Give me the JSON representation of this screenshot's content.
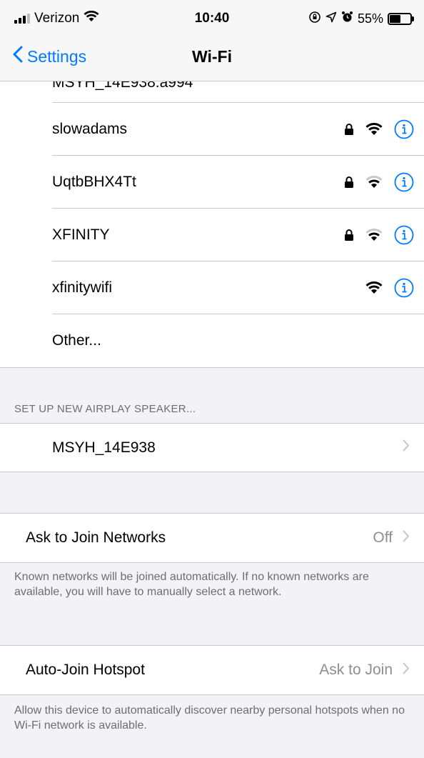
{
  "status_bar": {
    "carrier": "Verizon",
    "time": "10:40",
    "battery": "55%",
    "battery_level": 0.55
  },
  "nav": {
    "back_label": "Settings",
    "title": "Wi-Fi"
  },
  "partial_network": "MSYH_14E938.a994",
  "networks": [
    {
      "name": "slowadams",
      "locked": true,
      "strength": 3
    },
    {
      "name": "UqtbBHX4Tt",
      "locked": true,
      "strength": 2
    },
    {
      "name": "XFINITY",
      "locked": true,
      "strength": 2
    },
    {
      "name": "xfinitywifi",
      "locked": false,
      "strength": 3
    }
  ],
  "other_label": "Other...",
  "airplay": {
    "header": "SET UP NEW AIRPLAY SPEAKER...",
    "speaker": "MSYH_14E938"
  },
  "ask_to_join": {
    "label": "Ask to Join Networks",
    "value": "Off",
    "footer": "Known networks will be joined automatically. If no known networks are available, you will have to manually select a network."
  },
  "auto_join": {
    "label": "Auto-Join Hotspot",
    "value": "Ask to Join",
    "footer": "Allow this device to automatically discover nearby personal hotspots when no Wi-Fi network is available."
  },
  "colors": {
    "accent": "#007aff",
    "background": "#f2f2f7",
    "separator": "#c8c7cc",
    "secondary_text": "#6d6d72"
  }
}
